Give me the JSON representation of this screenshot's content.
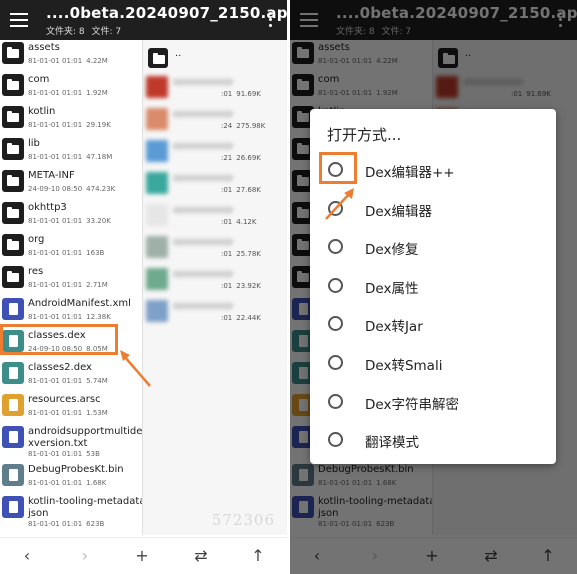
{
  "header": {
    "title": "....0beta.20240907_2150.apk/",
    "folders_label": "文件夹: 8",
    "files_label": "文件: 7"
  },
  "files": [
    {
      "name": "assets",
      "date": "81-01-01 01:01",
      "size": "4.22M",
      "icon": "folder-icon",
      "color": "#1e1e1e"
    },
    {
      "name": "com",
      "date": "81-01-01 01:01",
      "size": "1.92M",
      "icon": "folder-icon",
      "color": "#1e1e1e"
    },
    {
      "name": "kotlin",
      "date": "81-01-01 01:01",
      "size": "29.19K",
      "icon": "folder-icon",
      "color": "#1e1e1e"
    },
    {
      "name": "lib",
      "date": "81-01-01 01:01",
      "size": "47.18M",
      "icon": "folder-icon",
      "color": "#1e1e1e"
    },
    {
      "name": "META-INF",
      "date": "24-09-10 08:50",
      "size": "474.23K",
      "icon": "folder-icon",
      "color": "#1e1e1e"
    },
    {
      "name": "okhttp3",
      "date": "81-01-01 01:01",
      "size": "33.20K",
      "icon": "folder-icon",
      "color": "#1e1e1e"
    },
    {
      "name": "org",
      "date": "81-01-01 01:01",
      "size": "163B",
      "icon": "folder-icon",
      "color": "#1e1e1e"
    },
    {
      "name": "res",
      "date": "81-01-01 01:01",
      "size": "2.71M",
      "icon": "folder-icon",
      "color": "#1e1e1e"
    },
    {
      "name": "AndroidManifest.xml",
      "date": "81-01-01 01:01",
      "size": "12.38K",
      "icon": "xml-file-icon",
      "color": "#3f51b5"
    },
    {
      "name": "classes.dex",
      "date": "24-09-10 08:50",
      "size": "8.05M",
      "icon": "dex-file-icon",
      "color": "#3d8d8a"
    },
    {
      "name": "classes2.dex",
      "date": "81-01-01 01:01",
      "size": "5.74M",
      "icon": "dex-file-icon",
      "color": "#3d8d8a"
    },
    {
      "name": "resources.arsc",
      "date": "81-01-01 01:01",
      "size": "1.53M",
      "icon": "arsc-file-icon",
      "color": "#e0a030"
    },
    {
      "name": "androidsupportmultidexversion.txt",
      "name_line1": "androidsupportmultide",
      "name_line2": "xversion.txt",
      "date": "81-01-01 01:01",
      "size": "53B",
      "icon": "txt-file-icon",
      "color": "#3f51b5"
    },
    {
      "name": "DebugProbesKt.bin",
      "date": "81-01-01 01:01",
      "size": "1.68K",
      "icon": "bin-file-icon",
      "color": "#607d8b"
    },
    {
      "name": "kotlin-tooling-metadata.json",
      "name_line1": "kotlin-tooling-metadata.",
      "name_line2": "json",
      "date": "81-01-01 01:01",
      "size": "623B",
      "icon": "json-file-icon",
      "color": "#3f51b5"
    }
  ],
  "pane2": {
    "parent_label": "..",
    "rows": [
      {
        "time": ":01",
        "size": "91.69K",
        "color": "#c0392b"
      },
      {
        "time": ":24",
        "size": "275.98K",
        "color": "#d98b6a"
      },
      {
        "time": ":21",
        "size": "26.69K",
        "color": "#5b9bd5"
      },
      {
        "time": ":01",
        "size": "27.68K",
        "color": "#3aa89d"
      },
      {
        "time": ":01",
        "size": "4.12K",
        "color": "#e6e6e6"
      },
      {
        "time": ":01",
        "size": "25.78K",
        "color": "#9fb0a8"
      },
      {
        "time": ":01",
        "size": "23.92K",
        "color": "#6fa98e"
      },
      {
        "time": ":01",
        "size": "22.44K",
        "color": "#7fa0c8"
      }
    ],
    "watermark": "572306"
  },
  "dialog": {
    "title": "打开方式...",
    "options": [
      "Dex编辑器++",
      "Dex编辑器",
      "Dex修复",
      "Dex属性",
      "Dex转Jar",
      "Dex转Smali",
      "Dex字符串解密",
      "翻译模式"
    ]
  },
  "toolbar": {
    "back": "‹",
    "forward": "›",
    "add": "+",
    "swap": "⇄",
    "up": "↑"
  },
  "colors": {
    "accent": "#ed7d31",
    "header_bg": "#1f1f1f"
  }
}
